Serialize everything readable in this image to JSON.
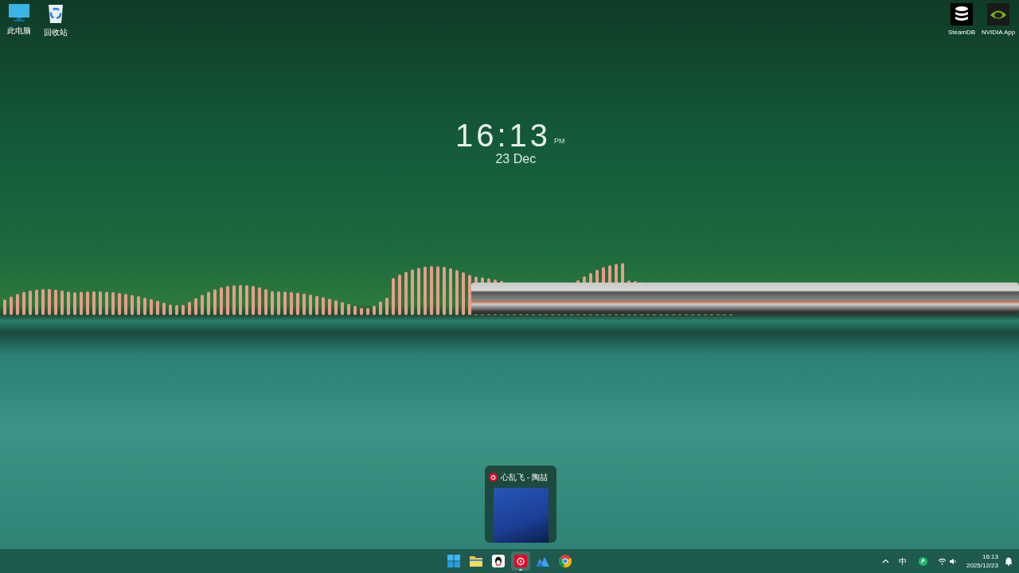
{
  "desktop_icons_left": [
    {
      "kind": "computer",
      "label": "此电脑"
    },
    {
      "kind": "recycle-bin",
      "label": "回收站"
    }
  ],
  "desktop_icons_right": [
    {
      "kind": "database",
      "label": "SteamDB"
    },
    {
      "kind": "nvidia",
      "label": "NVIDIA App"
    }
  ],
  "clock_widget": {
    "time": "16:13",
    "period": "PM",
    "date": "23 Dec"
  },
  "thumbnail_preview": {
    "title": "心乱飞 - 陶喆"
  },
  "taskbar_apps": [
    {
      "kind": "start",
      "active": false
    },
    {
      "kind": "folder",
      "active": false
    },
    {
      "kind": "penguin",
      "active": false
    },
    {
      "kind": "music",
      "active": true
    },
    {
      "kind": "photos",
      "active": false
    },
    {
      "kind": "browser",
      "active": false
    }
  ],
  "tray": {
    "ime": "中",
    "time": "16:13",
    "date": "2025/12/23"
  }
}
